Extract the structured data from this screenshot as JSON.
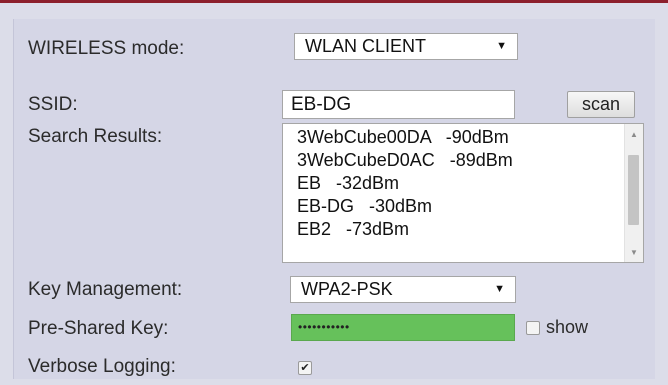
{
  "form": {
    "wireless_mode_label": "WIRELESS mode:",
    "wireless_mode_value": "WLAN CLIENT",
    "ssid_label": "SSID:",
    "ssid_value": "EB-DG",
    "scan_label": "scan",
    "search_results_label": "Search Results:",
    "search_results": [
      "3WebCube00DA   -90dBm",
      "3WebCubeD0AC   -89dBm",
      "EB   -32dBm",
      "EB-DG   -30dBm",
      "EB2   -73dBm"
    ],
    "key_management_label": "Key Management:",
    "key_management_value": "WPA2-PSK",
    "psk_label": "Pre-Shared Key:",
    "psk_value": "•••••••••••",
    "show_label": "show",
    "show_checked": false,
    "verbose_label": "Verbose Logging:",
    "verbose_checked": true
  },
  "colors": {
    "accent_bar": "#8c1f2c",
    "panel": "#d5d6e6",
    "psk_field": "#66c15b"
  },
  "icons": {
    "dropdown": "chevron-down-icon",
    "scroll_up": "scroll-up-arrow-icon",
    "scroll_down": "scroll-down-arrow-icon",
    "check": "checkmark-icon"
  }
}
